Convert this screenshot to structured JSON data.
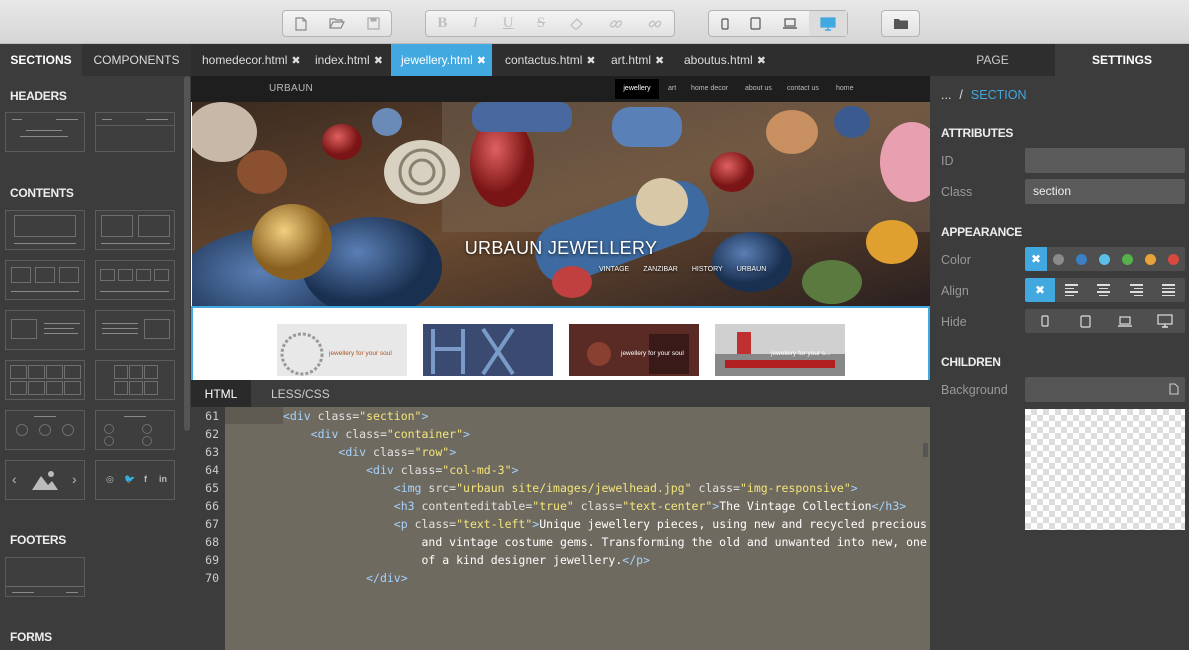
{
  "toolbar": {
    "file_icons": [
      "new-file-icon",
      "open-folder-icon",
      "save-icon"
    ],
    "format_buttons": {
      "bold": "B",
      "italic": "I",
      "underline": "U",
      "strike": "S"
    },
    "device_icons": [
      "phone-icon",
      "tablet-icon",
      "laptop-icon",
      "desktop-icon"
    ],
    "accent_color": "#42a8e0"
  },
  "tabs": {
    "left": {
      "sections": "SECTIONS",
      "components": "COMPONENTS"
    },
    "files": [
      {
        "label": "homedecor.html"
      },
      {
        "label": "index.html"
      },
      {
        "label": "jewellery.html",
        "active": true
      },
      {
        "label": "contactus.html"
      },
      {
        "label": "art.html"
      },
      {
        "label": "aboutus.html"
      }
    ],
    "close_glyph": "✖",
    "right": {
      "page": "PAGE",
      "settings": "SETTINGS"
    }
  },
  "left_sidebar": {
    "headers": "HEADERS",
    "contents": "CONTENTS",
    "footers": "FOOTERS",
    "forms": "FORMS"
  },
  "preview": {
    "brand": "URBAUN",
    "nav": [
      "jewellery",
      "art",
      "home decor",
      "about us",
      "contact us",
      "home"
    ],
    "active_nav": "jewellery",
    "hero_title": "URBAUN JEWELLERY",
    "hero_links": [
      "VINTAGE",
      "ZANZIBAR",
      "HISTORY",
      "URBAUN"
    ],
    "product_captions": [
      "jewellery for your soul",
      "",
      "jewellery for your soul",
      "jewellery for your s..."
    ]
  },
  "code_tabs": {
    "html": "HTML",
    "less": "LESS/CSS"
  },
  "code": {
    "line_numbers": [
      "61",
      "62",
      "63",
      "64",
      "65",
      "66",
      "67",
      "68",
      "69",
      "70"
    ]
  },
  "right_panel": {
    "breadcrumb_root": "...",
    "breadcrumb_sep": "/",
    "breadcrumb_current": "SECTION",
    "attributes": "ATTRIBUTES",
    "id_label": "ID",
    "id_value": "",
    "class_label": "Class",
    "class_value": "section",
    "appearance": "APPEARANCE",
    "color_label": "Color",
    "swatches": [
      "#8a8a8a",
      "#3b7fc4",
      "#5bbfe8",
      "#56b04c",
      "#e8a23a",
      "#d9493d"
    ],
    "align_label": "Align",
    "hide_label": "Hide",
    "children": "CHILDREN",
    "background_label": "Background"
  }
}
